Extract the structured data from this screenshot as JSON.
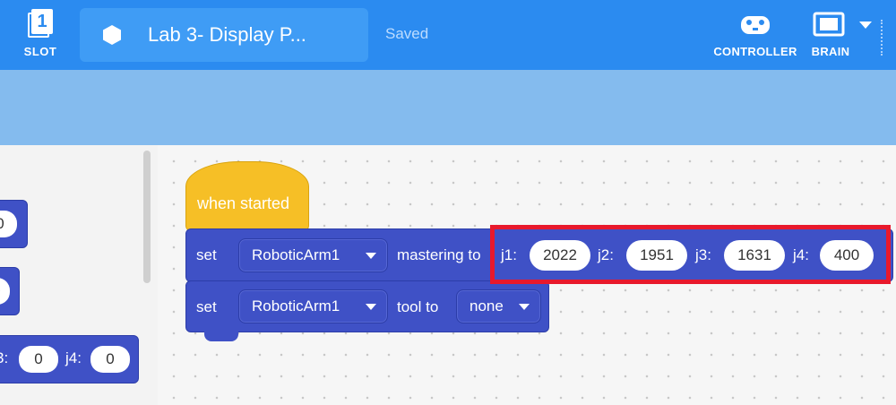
{
  "header": {
    "slot_number": "1",
    "slot_label": "SLOT",
    "project_title": "Lab 3- Display P...",
    "save_status": "Saved",
    "controller_label": "CONTROLLER",
    "brain_label": "BRAIN",
    "accent_color": "#2b8bf0"
  },
  "toolbox": {
    "frag1_value": "0",
    "frag2_value": "0",
    "frag3_prefix": "3:",
    "frag3_value": "0",
    "frag3_j4_label": "j4:",
    "frag3_j4_value": "0"
  },
  "script": {
    "hat_label": "when started",
    "block1": {
      "set_label": "set",
      "device": "RoboticArm1",
      "action": "mastering to",
      "j1_label": "j1:",
      "j1_value": "2022",
      "j2_label": "j2:",
      "j2_value": "1951",
      "j3_label": "j3:",
      "j3_value": "1631",
      "j4_label": "j4:",
      "j4_value": "400"
    },
    "block2": {
      "set_label": "set",
      "device": "RoboticArm1",
      "action": "tool to",
      "tool": "none"
    }
  },
  "icons": [
    "slot-icon",
    "hexagon-icon",
    "controller-icon",
    "brain-icon",
    "chevron-down-icon"
  ],
  "colors": {
    "block_blue": "#3f51c6",
    "event_yellow": "#f6bf26",
    "highlight_red": "#e8192c"
  }
}
